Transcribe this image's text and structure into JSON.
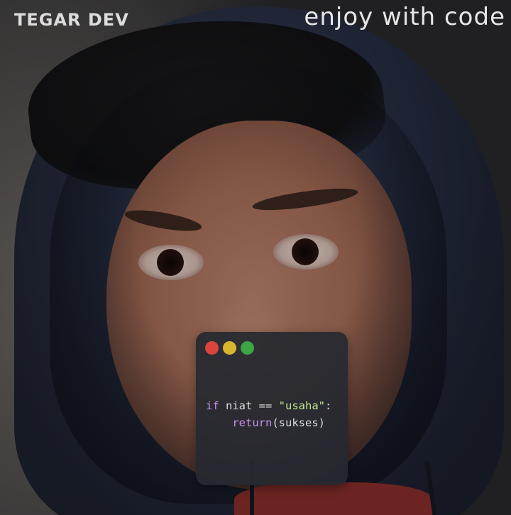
{
  "header": {
    "brand": "TEGAR DEV",
    "tagline": "enjoy with code"
  },
  "code_window": {
    "dots": [
      {
        "name": "close-dot",
        "color": "#d9453c"
      },
      {
        "name": "minimize-dot",
        "color": "#d8b52c"
      },
      {
        "name": "maximize-dot",
        "color": "#3ea544"
      }
    ],
    "line1": {
      "keyword": "if",
      "variable": " niat ",
      "operator": "==",
      "string": " \"usaha\"",
      "colon": ":"
    },
    "line2": {
      "indent": "    ",
      "keyword": "return",
      "args": "(sukses)"
    }
  },
  "colors": {
    "keyword": "#c792ea",
    "string": "#c3e88d",
    "window_bg": "#262930"
  }
}
